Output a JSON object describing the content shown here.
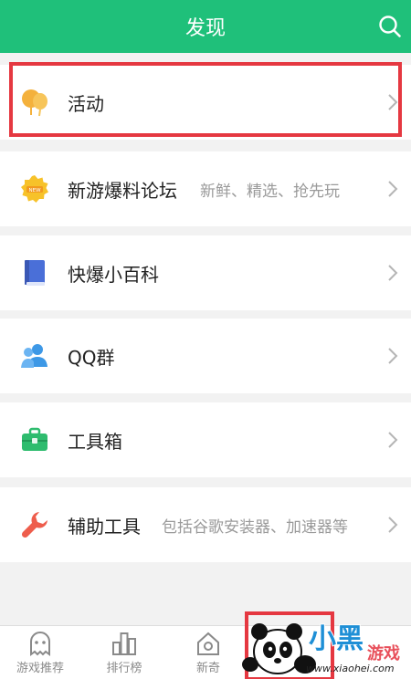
{
  "header": {
    "title": "发现",
    "search_icon": "search-icon"
  },
  "colors": {
    "accent": "#1fc07a",
    "highlight": "#e53841"
  },
  "items": [
    {
      "label": "活动",
      "subtitle": "",
      "icon": "balloon-icon"
    },
    {
      "label": "新游爆料论坛",
      "subtitle": "新鲜、精选、抢先玩",
      "icon": "new-badge-icon"
    },
    {
      "label": "快爆小百科",
      "subtitle": "",
      "icon": "book-icon"
    },
    {
      "label": "QQ群",
      "subtitle": "",
      "icon": "users-icon"
    },
    {
      "label": "工具箱",
      "subtitle": "",
      "icon": "toolbox-icon"
    },
    {
      "label": "辅助工具",
      "subtitle": "包括谷歌安装器、加速器等",
      "icon": "wrench-icon"
    }
  ],
  "tabs": [
    {
      "label": "游戏推荐",
      "icon": "game-ghost-icon"
    },
    {
      "label": "排行榜",
      "icon": "ranking-icon"
    },
    {
      "label": "新奇",
      "icon": "house-icon"
    }
  ],
  "watermark": {
    "logo_text": "小黑游戏",
    "url": "www.xiaohei.com"
  }
}
